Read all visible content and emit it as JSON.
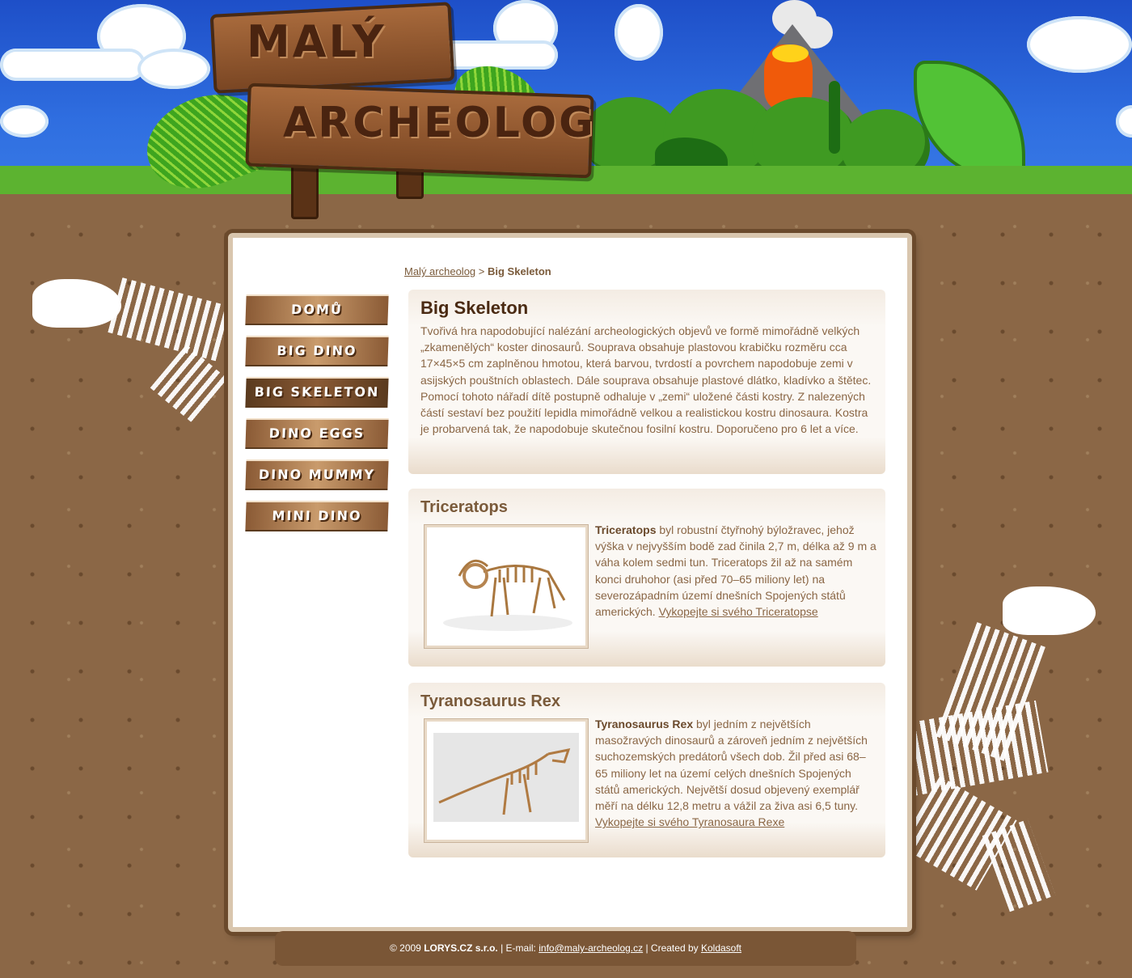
{
  "site": {
    "logo_line1": "MALÝ",
    "logo_line2": "ARCHEOLOG"
  },
  "breadcrumb": {
    "home": "Malý archeolog",
    "separator": ">",
    "current": "Big Skeleton"
  },
  "nav": {
    "items": [
      {
        "label": "DOMŮ"
      },
      {
        "label": "BIG DINO"
      },
      {
        "label": "BIG SKELETON"
      },
      {
        "label": "DINO EGGS"
      },
      {
        "label": "DINO MUMMY"
      },
      {
        "label": "MINI DINO"
      }
    ]
  },
  "intro": {
    "title": "Big Skeleton",
    "text": "Tvořivá hra napodobující nalézání archeologických objevů ve formě mimořádně velkých „zkamenělých“ koster dinosaurů. Souprava obsahuje plastovou krabičku rozměru cca 17×45×5 cm zaplněnou hmotou, která barvou, tvrdostí a povrchem napodobuje zemi v asijských pouštních oblastech. Dále souprava obsahuje plastové dlátko, kladívko a štětec. Pomocí tohoto nářadí dítě postupně odhaluje v „zemi“ uložené části kostry. Z nalezených částí sestaví bez použití lepidla mimořádně velkou a realistickou kostru dinosaura. Kostra je probarvená tak, že napodobuje skutečnou fosilní kostru. Doporučeno pro 6 let a více."
  },
  "products": [
    {
      "title": "Triceratops",
      "name": "Triceratops",
      "text": " byl robustní čtyřnohý býložravec, jehož výška v nejvyšším bodě zad činila 2,7 m, délka až 9 m a váha kolem sedmi tun. Triceratops žil až na samém konci druhohor (asi před 70–65 miliony let) na severozápadním území dnešních Spojených států amerických. ",
      "link": "Vykopejte si svého Triceratopse"
    },
    {
      "title": "Tyranosaurus Rex",
      "name": "Tyranosaurus Rex",
      "text": " byl jedním z největších masožravých dinosaurů a zároveň jedním z největších suchozemských predátorů všech dob. Žil před asi 68–65 miliony let na území celých dnešních Spojených států amerických. Největší dosud objevený exemplář měří na délku 12,8 metru a vážil za živa asi 6,5 tuny. ",
      "link": "Vykopejte si svého Tyranosaura Rexe"
    }
  ],
  "footer": {
    "copyright": "© 2009 ",
    "company": "LORYS.CZ s.r.o.",
    "email_label": " | E-mail: ",
    "email": "info@maly-archeolog.cz",
    "created_label": " | Created by ",
    "creator": "Koldasoft"
  },
  "colors": {
    "sky": "#2f6ee0",
    "soil": "#8b6746",
    "text": "#8a6645",
    "heading": "#4a2a12",
    "footer_bg": "#7a5636"
  }
}
